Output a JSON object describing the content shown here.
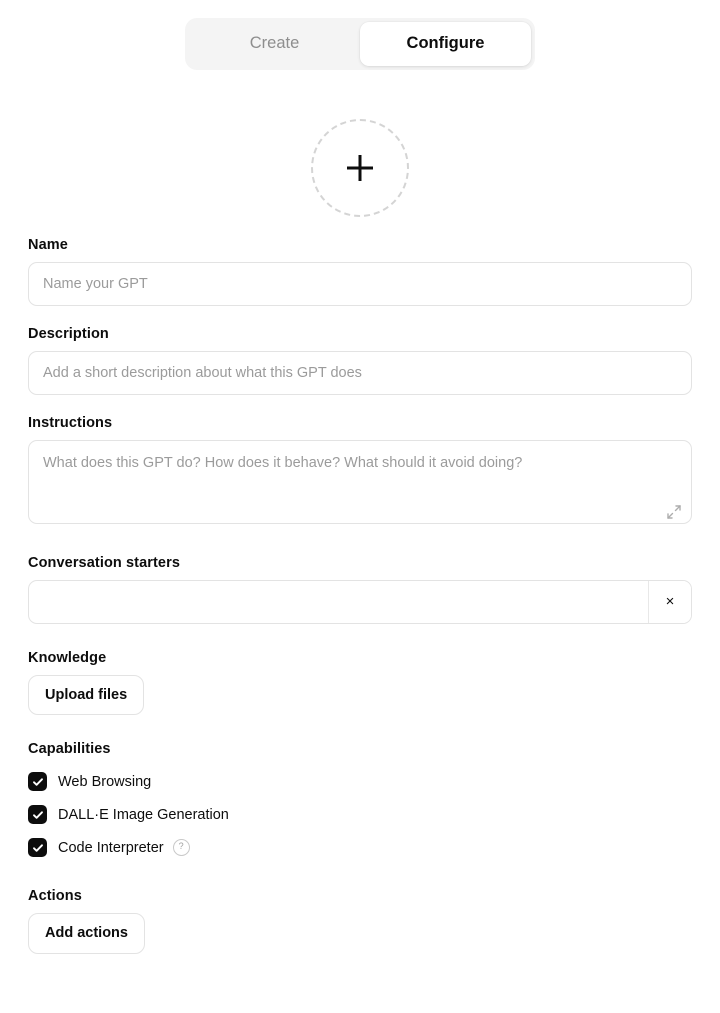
{
  "tabs": [
    {
      "label": "Create",
      "active": false
    },
    {
      "label": "Configure",
      "active": true
    }
  ],
  "avatar": {
    "icon": "plus-icon",
    "aria": "Upload GPT profile picture"
  },
  "fields": {
    "name": {
      "label": "Name",
      "placeholder": "Name your GPT",
      "value": ""
    },
    "description": {
      "label": "Description",
      "placeholder": "Add a short description about what this GPT does",
      "value": ""
    },
    "instructions": {
      "label": "Instructions",
      "placeholder": "What does this GPT do? How does it behave? What should it avoid doing?",
      "value": "",
      "expand_icon": "expand-diagonal-icon"
    },
    "conversation_starters": {
      "label": "Conversation starters",
      "rows": [
        {
          "placeholder": "",
          "value": "",
          "remove_icon": "close-icon",
          "remove_label": "×"
        }
      ]
    },
    "knowledge": {
      "label": "Knowledge",
      "upload_button": "Upload files"
    },
    "capabilities": {
      "label": "Capabilities",
      "items": [
        {
          "label": "Web Browsing",
          "checked": true,
          "help": false
        },
        {
          "label": "DALL·E Image Generation",
          "checked": true,
          "help": false
        },
        {
          "label": "Code Interpreter",
          "checked": true,
          "help": true,
          "help_glyph": "?"
        }
      ]
    },
    "actions": {
      "label": "Actions",
      "add_button": "Add actions"
    }
  },
  "colors": {
    "accent": "#0d0d0d",
    "tab_track": "#f4f4f4",
    "border": "#e3e3e3",
    "placeholder": "#9b9b9b",
    "muted_text": "#8e8e8e"
  }
}
